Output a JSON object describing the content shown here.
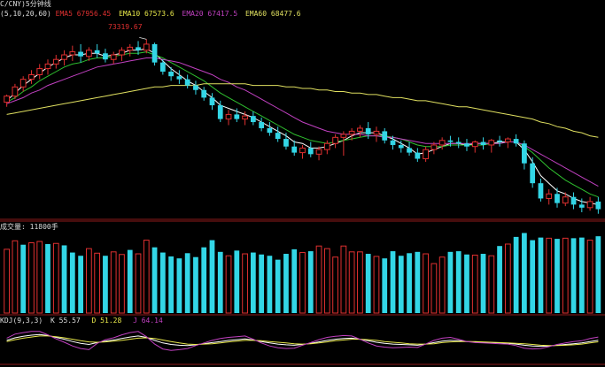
{
  "colors": {
    "background": "#000000",
    "up": "#e03030",
    "down": "#33d6e6",
    "divider": "#8b1a1a",
    "ema5": "#ffffff",
    "ema10": "#e8e84a",
    "ema20": "#c040c0",
    "ema60": "#e0e060",
    "ema_green": "#2fc02f"
  },
  "header": {
    "title": "C/CNY)5分钟线",
    "params": "(5,10,20,60)",
    "ema5": "EMA5 67956.45",
    "ema10": "EMA10 67573.6",
    "ema20": "EMA20 67417.5",
    "ema60": "EMA60 68477.6"
  },
  "price_high_label": "73319.67",
  "volume_header": "成交量: 11800手",
  "kdj_header": {
    "params": "KDJ(9,3,3)",
    "k": "K 55.57",
    "d": "D 51.28",
    "j": "J 64.14"
  },
  "chart_data": [
    {
      "type": "candlestick",
      "title": "",
      "price_range": [
        62000,
        74500
      ],
      "candles": [
        [
          69200,
          69700,
          68900,
          69600
        ],
        [
          69600,
          70400,
          69400,
          70200
        ],
        [
          70200,
          70900,
          69900,
          70700
        ],
        [
          70700,
          71300,
          70400,
          71000
        ],
        [
          71000,
          71700,
          70700,
          71400
        ],
        [
          71400,
          72000,
          71000,
          71700
        ],
        [
          71700,
          72300,
          71400,
          72000
        ],
        [
          72000,
          72600,
          71600,
          72300
        ],
        [
          72300,
          72900,
          71900,
          72500
        ],
        [
          72500,
          73000,
          71800,
          72200
        ],
        [
          72200,
          72800,
          71900,
          72600
        ],
        [
          72600,
          73000,
          72100,
          72400
        ],
        [
          72400,
          72700,
          71800,
          72000
        ],
        [
          72000,
          72500,
          71700,
          72300
        ],
        [
          72300,
          72800,
          71900,
          72600
        ],
        [
          72600,
          73000,
          72200,
          72800
        ],
        [
          72800,
          73200,
          72300,
          72600
        ],
        [
          72600,
          73319.67,
          72400,
          73000
        ],
        [
          73000,
          73100,
          71600,
          71800
        ],
        [
          71800,
          72000,
          71000,
          71200
        ],
        [
          71200,
          71500,
          70600,
          70900
        ],
        [
          70900,
          71300,
          70400,
          70700
        ],
        [
          70700,
          71000,
          70100,
          70300
        ],
        [
          70300,
          70600,
          69700,
          70000
        ],
        [
          70000,
          70200,
          69300,
          69500
        ],
        [
          69500,
          69800,
          68700,
          69000
        ],
        [
          69000,
          69300,
          67900,
          68100
        ],
        [
          68100,
          68700,
          67700,
          68400
        ],
        [
          68400,
          68800,
          67900,
          68100
        ],
        [
          68100,
          68600,
          67700,
          68300
        ],
        [
          68300,
          68600,
          67700,
          67900
        ],
        [
          67900,
          68200,
          67300,
          67500
        ],
        [
          67500,
          67900,
          67000,
          67200
        ],
        [
          67200,
          67600,
          66600,
          66800
        ],
        [
          66800,
          67200,
          66100,
          66300
        ],
        [
          66300,
          66700,
          65700,
          65900
        ],
        [
          65900,
          66400,
          65500,
          66200
        ],
        [
          66200,
          66600,
          65600,
          65800
        ],
        [
          65800,
          66300,
          65400,
          66100
        ],
        [
          66100,
          66700,
          65800,
          66500
        ],
        [
          66500,
          67100,
          66200,
          66900
        ],
        [
          66900,
          67300,
          65700,
          67100
        ],
        [
          67100,
          67500,
          66700,
          67300
        ],
        [
          67300,
          67700,
          66900,
          67500
        ],
        [
          67500,
          67900,
          66800,
          67100
        ],
        [
          67100,
          67600,
          66600,
          67300
        ],
        [
          67300,
          67500,
          66500,
          66700
        ],
        [
          66700,
          67000,
          66100,
          66400
        ],
        [
          66400,
          66700,
          65900,
          66200
        ],
        [
          66200,
          66600,
          65700,
          65900
        ],
        [
          65900,
          66200,
          65300,
          65500
        ],
        [
          65500,
          66300,
          65300,
          66100
        ],
        [
          66100,
          66600,
          65800,
          66400
        ],
        [
          66400,
          66900,
          66100,
          66700
        ],
        [
          66700,
          67000,
          66300,
          66600
        ],
        [
          66600,
          66900,
          66200,
          66500
        ],
        [
          66500,
          66800,
          66000,
          66300
        ],
        [
          66300,
          66700,
          65900,
          66600
        ],
        [
          66600,
          66900,
          66100,
          66400
        ],
        [
          66400,
          66800,
          65900,
          66700
        ],
        [
          66700,
          67000,
          66300,
          66600
        ],
        [
          66600,
          66900,
          66200,
          66800
        ],
        [
          66800,
          67100,
          66300,
          66500
        ],
        [
          66500,
          66700,
          64800,
          65200
        ],
        [
          65200,
          65600,
          63600,
          63900
        ],
        [
          63900,
          64200,
          62700,
          62900
        ],
        [
          62900,
          63500,
          62500,
          63200
        ],
        [
          63200,
          63600,
          62300,
          62600
        ],
        [
          62600,
          63300,
          62400,
          63000
        ],
        [
          63000,
          63300,
          62200,
          62500
        ],
        [
          62500,
          62900,
          62000,
          62300
        ],
        [
          62300,
          63000,
          62100,
          62700
        ],
        [
          62700,
          63000,
          61900,
          62200
        ]
      ],
      "ema_series": [
        {
          "name": "EMA5",
          "values": [
            69300,
            69800,
            70300,
            70700,
            71100,
            71500,
            71800,
            72100,
            72300,
            72300,
            72400,
            72400,
            72200,
            72300,
            72400,
            72600,
            72600,
            72700,
            72400,
            71900,
            71400,
            71000,
            70600,
            70300,
            69900,
            69500,
            69000,
            68800,
            68600,
            68400,
            68200,
            67900,
            67600,
            67300,
            67000,
            66600,
            66500,
            66200,
            66200,
            66300,
            66500,
            66700,
            67000,
            67200,
            67200,
            67200,
            67000,
            66800,
            66500,
            66200,
            65800,
            65900,
            66100,
            66300,
            66500,
            66500,
            66400,
            66500,
            66500,
            66500,
            66600,
            66600,
            66600,
            66100,
            65300,
            64400,
            63900,
            63400,
            63200,
            62900,
            62700,
            62600,
            62500
          ]
        },
        {
          "name": "EMA10",
          "values": [
            69200,
            69500,
            69900,
            70200,
            70600,
            70900,
            71200,
            71500,
            71700,
            71800,
            72000,
            72100,
            72100,
            72200,
            72300,
            72400,
            72400,
            72500,
            72300,
            72100,
            71800,
            71500,
            71200,
            70900,
            70600,
            70200,
            69800,
            69500,
            69200,
            68900,
            68600,
            68300,
            68000,
            67700,
            67400,
            67100,
            66900,
            66700,
            66600,
            66500,
            66600,
            66700,
            66800,
            66900,
            67000,
            67000,
            67000,
            66900,
            66800,
            66600,
            66400,
            66300,
            66300,
            66300,
            66400,
            66400,
            66400,
            66400,
            66400,
            66500,
            66500,
            66600,
            66600,
            66300,
            65900,
            65400,
            64900,
            64500,
            64100,
            63800,
            63500,
            63200,
            63000
          ]
        },
        {
          "name": "EMA20",
          "values": [
            69100,
            69300,
            69500,
            69800,
            70000,
            70300,
            70500,
            70700,
            70900,
            71100,
            71300,
            71500,
            71600,
            71700,
            71800,
            71900,
            72000,
            72100,
            72100,
            72000,
            71900,
            71800,
            71600,
            71400,
            71200,
            71000,
            70700,
            70500,
            70200,
            70000,
            69700,
            69400,
            69100,
            68800,
            68500,
            68200,
            67900,
            67700,
            67500,
            67300,
            67200,
            67100,
            67100,
            67100,
            67000,
            67000,
            66900,
            66900,
            66800,
            66700,
            66600,
            66500,
            66500,
            66500,
            66500,
            66500,
            66500,
            66500,
            66500,
            66500,
            66500,
            66600,
            66600,
            66400,
            66100,
            65800,
            65500,
            65200,
            64900,
            64600,
            64300,
            64000,
            63700
          ]
        },
        {
          "name": "EMA60",
          "values": [
            68400,
            68500,
            68600,
            68700,
            68800,
            68900,
            69000,
            69100,
            69200,
            69300,
            69400,
            69500,
            69600,
            69700,
            69800,
            69900,
            70000,
            70100,
            70200,
            70200,
            70300,
            70300,
            70300,
            70300,
            70400,
            70400,
            70400,
            70400,
            70400,
            70400,
            70300,
            70300,
            70300,
            70300,
            70200,
            70200,
            70100,
            70100,
            70000,
            70000,
            69900,
            69900,
            69800,
            69800,
            69700,
            69700,
            69600,
            69500,
            69500,
            69400,
            69300,
            69300,
            69200,
            69100,
            69000,
            68900,
            68900,
            68800,
            68700,
            68600,
            68500,
            68400,
            68300,
            68200,
            68100,
            67900,
            67800,
            67600,
            67500,
            67300,
            67200,
            67000,
            66900
          ]
        }
      ],
      "high_annotation": {
        "value": 73319.67,
        "index": 17
      }
    },
    {
      "type": "bar",
      "title": "",
      "volume_range": [
        0,
        12500
      ],
      "values": [
        9800,
        11100,
        10500,
        10800,
        11000,
        10600,
        10700,
        10400,
        9300,
        8800,
        9900,
        9200,
        8800,
        9400,
        9000,
        9700,
        9100,
        11200,
        10100,
        9300,
        8700,
        8400,
        9200,
        8600,
        10100,
        11200,
        9400,
        8800,
        9600,
        9100,
        9300,
        9000,
        8800,
        8200,
        9100,
        9800,
        9300,
        9500,
        10300,
        9900,
        8600,
        10300,
        9400,
        9400,
        9100,
        8700,
        8400,
        9500,
        8800,
        9200,
        9400,
        9100,
        7600,
        8600,
        9400,
        9500,
        9000,
        8900,
        9100,
        8800,
        10300,
        10600,
        11700,
        12300,
        11200,
        11600,
        11500,
        11400,
        11500,
        11500,
        11600,
        11200,
        11800
      ],
      "up": [
        true,
        true,
        false,
        true,
        true,
        false,
        true,
        false,
        false,
        false,
        true,
        true,
        false,
        true,
        true,
        false,
        true,
        true,
        false,
        false,
        false,
        false,
        false,
        false,
        false,
        false,
        false,
        true,
        false,
        true,
        false,
        false,
        false,
        false,
        false,
        false,
        true,
        false,
        true,
        true,
        true,
        true,
        true,
        true,
        false,
        true,
        false,
        false,
        false,
        false,
        false,
        true,
        true,
        true,
        false,
        false,
        false,
        true,
        false,
        true,
        false,
        true,
        false,
        false,
        false,
        false,
        true,
        false,
        true,
        false,
        false,
        true,
        false
      ]
    },
    {
      "type": "line",
      "title": "",
      "kdj_range": [
        0,
        100
      ],
      "series": [
        {
          "name": "K",
          "values": [
            55,
            62,
            66,
            69,
            71,
            68,
            63,
            58,
            52,
            47,
            44,
            49,
            53,
            56,
            60,
            64,
            67,
            63,
            55,
            48,
            44,
            42,
            41,
            43,
            46,
            49,
            52,
            55,
            57,
            59,
            56,
            52,
            48,
            45,
            43,
            42,
            44,
            47,
            51,
            55,
            58,
            60,
            61,
            58,
            54,
            50,
            47,
            45,
            44,
            43,
            42,
            45,
            49,
            53,
            55,
            54,
            52,
            51,
            50,
            49,
            48,
            47,
            45,
            42,
            40,
            39,
            40,
            42,
            44,
            46,
            48,
            52,
            55.57
          ]
        },
        {
          "name": "D",
          "values": [
            52,
            57,
            61,
            64,
            67,
            67,
            65,
            62,
            58,
            54,
            51,
            50,
            51,
            53,
            55,
            58,
            61,
            62,
            60,
            56,
            52,
            48,
            45,
            44,
            45,
            46,
            48,
            51,
            53,
            55,
            55,
            54,
            52,
            50,
            48,
            46,
            45,
            46,
            48,
            51,
            54,
            56,
            58,
            58,
            57,
            55,
            52,
            50,
            48,
            46,
            45,
            45,
            46,
            49,
            51,
            52,
            52,
            52,
            51,
            50,
            49,
            48,
            47,
            46,
            44,
            42,
            41,
            41,
            42,
            43,
            45,
            48,
            51.28
          ]
        },
        {
          "name": "J",
          "values": [
            61,
            72,
            76,
            79,
            79,
            70,
            59,
            50,
            40,
            33,
            30,
            47,
            57,
            62,
            70,
            76,
            79,
            65,
            45,
            32,
            28,
            30,
            33,
            41,
            48,
            55,
            60,
            63,
            65,
            67,
            58,
            48,
            40,
            35,
            33,
            34,
            42,
            49,
            57,
            63,
            66,
            68,
            67,
            58,
            48,
            40,
            37,
            35,
            36,
            37,
            36,
            45,
            55,
            61,
            63,
            58,
            52,
            49,
            48,
            47,
            46,
            45,
            41,
            34,
            32,
            33,
            38,
            44,
            48,
            52,
            54,
            60,
            64.14
          ]
        }
      ]
    }
  ]
}
